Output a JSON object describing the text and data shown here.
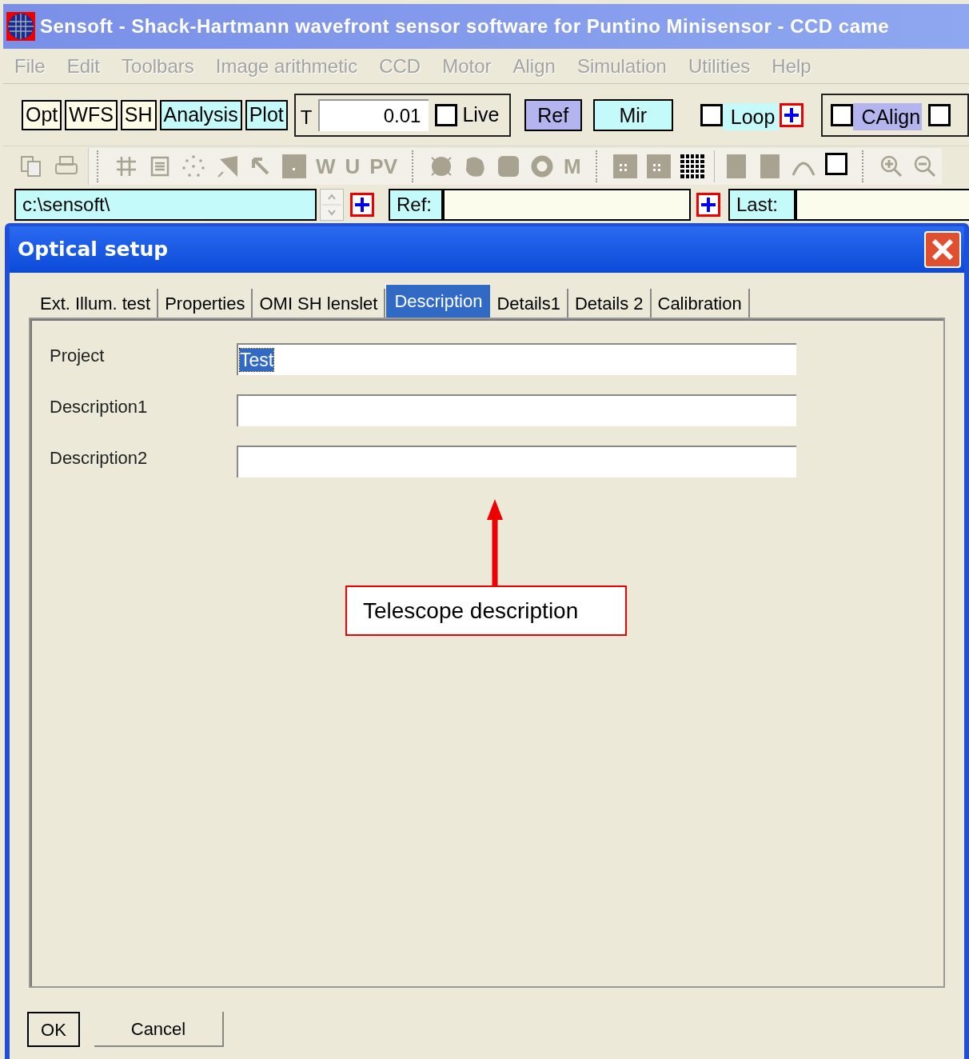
{
  "window": {
    "title": "Sensoft - Shack-Hartmann wavefront sensor software for Puntino Minisensor - CCD came"
  },
  "menu": [
    {
      "label": "File",
      "disabled": true
    },
    {
      "label": "Edit",
      "disabled": true
    },
    {
      "label": "Toolbars",
      "disabled": true
    },
    {
      "label": "Image arithmetic",
      "disabled": true
    },
    {
      "label": "CCD",
      "disabled": true
    },
    {
      "label": "Motor",
      "disabled": true
    },
    {
      "label": "Align",
      "disabled": true
    },
    {
      "label": "Simulation",
      "disabled": true
    },
    {
      "label": "Utilities",
      "disabled": true
    },
    {
      "label": "Help",
      "disabled": true
    }
  ],
  "toolbar": {
    "buttons": [
      {
        "label": "Opt",
        "color": "#fcfce6"
      },
      {
        "label": "WFS",
        "color": "#fcfce6"
      },
      {
        "label": "SH",
        "color": "#fcfce6"
      },
      {
        "label": "Analysis",
        "color": "#c4fafa"
      },
      {
        "label": "Plot",
        "color": "#c4fafa"
      }
    ],
    "t_label": "T",
    "t_value": "0.01",
    "live": {
      "label": "Live",
      "checked": false
    },
    "actions": [
      {
        "label": "Ref",
        "color": "#b4b4ee"
      },
      {
        "label": "Mir",
        "color": "#c4fafa"
      }
    ],
    "loop": {
      "label": "Loop",
      "checked": false
    },
    "calign": {
      "label": "CAlign",
      "checked": false
    },
    "extra_checkbox": {
      "checked": false
    }
  },
  "icon_toolbar": {
    "letters": [
      "W",
      "U",
      "PV",
      "M"
    ],
    "checkbox_checked": false
  },
  "path_bar": {
    "path": "c:\\sensoft\\",
    "ref_label": "Ref:",
    "last_label": "Last:"
  },
  "dialog": {
    "title": "Optical setup",
    "tabs": [
      {
        "label": "Ext. Illum. test",
        "selected": false
      },
      {
        "label": "Properties",
        "selected": false
      },
      {
        "label": "OMI SH lenslet",
        "selected": false
      },
      {
        "label": "Description",
        "selected": true
      },
      {
        "label": "Details1",
        "selected": false
      },
      {
        "label": "Details 2",
        "selected": false
      },
      {
        "label": "Calibration",
        "selected": false
      }
    ],
    "fields": [
      {
        "label": "Project",
        "value": "Test",
        "selected": true
      },
      {
        "label": "Description1"
      },
      {
        "label": "Description2"
      }
    ],
    "annotation": "Telescope description",
    "buttons": [
      "OK",
      "Cancel"
    ]
  }
}
